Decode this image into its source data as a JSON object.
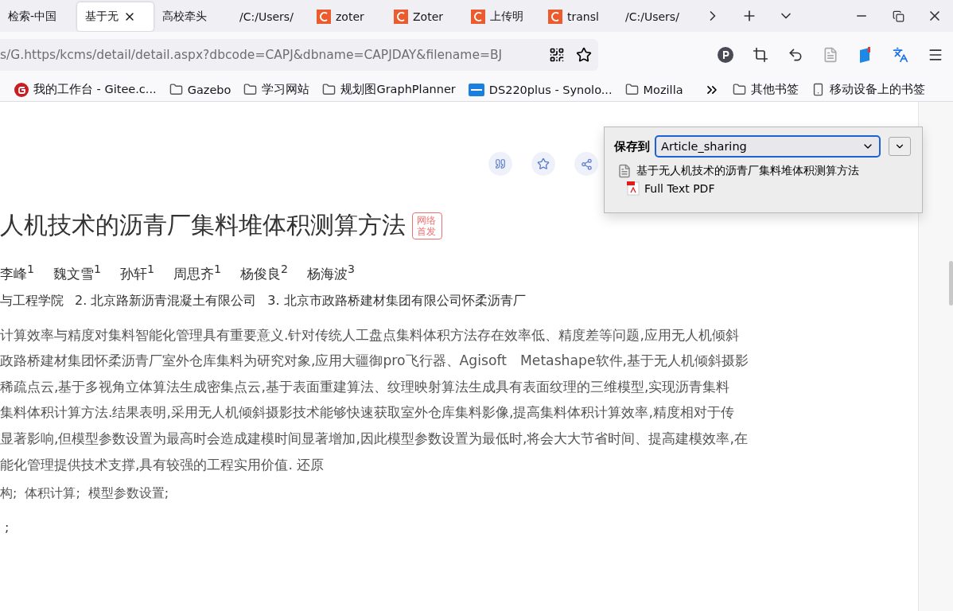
{
  "tabs": [
    {
      "title": "检索-中国",
      "kind": "plain",
      "selected": false
    },
    {
      "title": "基于无",
      "kind": "plain",
      "selected": true
    },
    {
      "title": "高校牵头",
      "kind": "plain",
      "selected": false
    },
    {
      "title": "/C:/Users/",
      "kind": "plain",
      "selected": false
    },
    {
      "title": "zoter",
      "kind": "zotero",
      "selected": false
    },
    {
      "title": "Zoter",
      "kind": "zotero",
      "selected": false
    },
    {
      "title": "上传明",
      "kind": "zotero",
      "selected": false
    },
    {
      "title": "transl",
      "kind": "zotero",
      "selected": false
    },
    {
      "title": "/C:/Users/",
      "kind": "plain",
      "selected": false
    }
  ],
  "address_bar": {
    "url": "s/G.https/kcms/detail/detail.aspx?dbcode=CAPJ&dbname=CAPJDAY&filename=BJ"
  },
  "bookmarks": [
    {
      "label": "我的工作台 - Gitee.c...",
      "kind": "site"
    },
    {
      "label": "Gazebo",
      "kind": "folder"
    },
    {
      "label": "学习网站",
      "kind": "folder"
    },
    {
      "label": "规划图GraphPlanner",
      "kind": "folder"
    },
    {
      "label": "DS220plus - Synolo...",
      "kind": "nas"
    },
    {
      "label": "Mozilla",
      "kind": "folder"
    }
  ],
  "other_bookmarks": [
    {
      "label": "其他书签",
      "kind": "folder"
    },
    {
      "label": "移动设备上的书签",
      "kind": "phone"
    }
  ],
  "article": {
    "title": "人机技术的沥青厂集料堆体积测算方法",
    "badge": "网络首发",
    "authors": [
      "李峰$^{1}$",
      "魏文雪$^{1}$",
      "孙轩$^{1}$",
      "周思齐$^{1}$",
      "杨俊良$^{2}$",
      "杨海波$^{3}$"
    ],
    "affiliations": [
      "与工程学院",
      "2. 北京路新沥青混凝土有限公司",
      "3. 北京市政路桥建材集团有限公司怀柔沥青厂"
    ],
    "abstract_lines": [
      "计算效率与精度对集料智能化管理具有重要意义.针对传统人工盘点集料体积方法存在效率低、精度差等问题,应用无人机倾斜",
      "政路桥建材集团怀柔沥青厂室外仓库集料为研究对象,应用大疆御pro飞行器、Agisoft　Metashape软件,基于无人机倾斜摄影",
      "稀疏点云,基于多视角立体算法生成密集点云,基于表面重建算法、纹理映射算法生成具有表面纹理的三维模型,实现沥青集料",
      "集料体积计算方法.结果表明,采用无人机倾斜摄影技术能够快速获取室外仓库集料影像,提高集料体积计算效率,精度相对于传",
      "显著影响,但模型参数设置为最高时会造成建模时间显著增加,因此模型参数设置为最低时,将会大大节省时间、提高建模效率,在",
      "能化管理提供技术支撑,具有较强的工程实用价值."
    ],
    "restore_link": "还原",
    "keywords": [
      "构;",
      "体积计算;",
      "模型参数设置;"
    ],
    "fund": ";"
  },
  "zotero_popup": {
    "label": "保存到",
    "collection": "Article_sharing",
    "items": [
      {
        "kind": "webpage",
        "title": "基于无人机技术的沥青厂集料堆体积测算方法",
        "children": [
          {
            "kind": "pdf",
            "title": "Full Text PDF"
          }
        ]
      }
    ]
  }
}
